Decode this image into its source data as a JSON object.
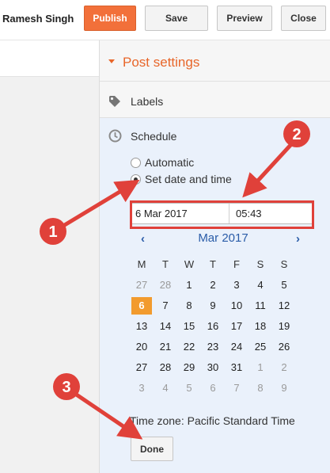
{
  "header": {
    "username": "Ramesh Singh",
    "publish_label": "Publish",
    "save_label": "Save",
    "preview_label": "Preview",
    "close_label": "Close"
  },
  "sidebar": {
    "post_settings_title": "Post settings",
    "labels_title": "Labels",
    "schedule": {
      "title": "Schedule",
      "option_automatic": "Automatic",
      "option_set": "Set date and time",
      "selected_option": "Set date and time",
      "date_value": "6 Mar 2017",
      "time_value": "05:43",
      "timezone": "Time zone: Pacific Standard Time",
      "done_label": "Done"
    }
  },
  "calendar": {
    "prev_icon": "‹",
    "next_icon": "›",
    "month_label": "Mar 2017",
    "weekdays": [
      "M",
      "T",
      "W",
      "T",
      "F",
      "S",
      "S"
    ],
    "selected_day": "6",
    "weeks": [
      [
        {
          "d": "27",
          "dim": true
        },
        {
          "d": "28",
          "dim": true
        },
        {
          "d": "1"
        },
        {
          "d": "2"
        },
        {
          "d": "3"
        },
        {
          "d": "4"
        },
        {
          "d": "5"
        }
      ],
      [
        {
          "d": "6"
        },
        {
          "d": "7"
        },
        {
          "d": "8"
        },
        {
          "d": "9"
        },
        {
          "d": "10"
        },
        {
          "d": "11"
        },
        {
          "d": "12"
        }
      ],
      [
        {
          "d": "13"
        },
        {
          "d": "14"
        },
        {
          "d": "15"
        },
        {
          "d": "16"
        },
        {
          "d": "17"
        },
        {
          "d": "18"
        },
        {
          "d": "19"
        }
      ],
      [
        {
          "d": "20"
        },
        {
          "d": "21"
        },
        {
          "d": "22"
        },
        {
          "d": "23"
        },
        {
          "d": "24"
        },
        {
          "d": "25"
        },
        {
          "d": "26"
        }
      ],
      [
        {
          "d": "27"
        },
        {
          "d": "28"
        },
        {
          "d": "29"
        },
        {
          "d": "30"
        },
        {
          "d": "31"
        },
        {
          "d": "1",
          "dim": true
        },
        {
          "d": "2",
          "dim": true
        }
      ],
      [
        {
          "d": "3",
          "dim": true
        },
        {
          "d": "4",
          "dim": true
        },
        {
          "d": "5",
          "dim": true
        },
        {
          "d": "6",
          "dim": true
        },
        {
          "d": "7",
          "dim": true
        },
        {
          "d": "8",
          "dim": true
        },
        {
          "d": "9",
          "dim": true
        }
      ]
    ]
  },
  "annotations": {
    "badge_1": "1",
    "badge_2": "2",
    "badge_3": "3",
    "color": "#e0413a"
  },
  "colors": {
    "accent": "#e8662a",
    "publish": "#f2703a",
    "selected_day": "#f29b2e",
    "link_blue": "#2a5ca8"
  }
}
